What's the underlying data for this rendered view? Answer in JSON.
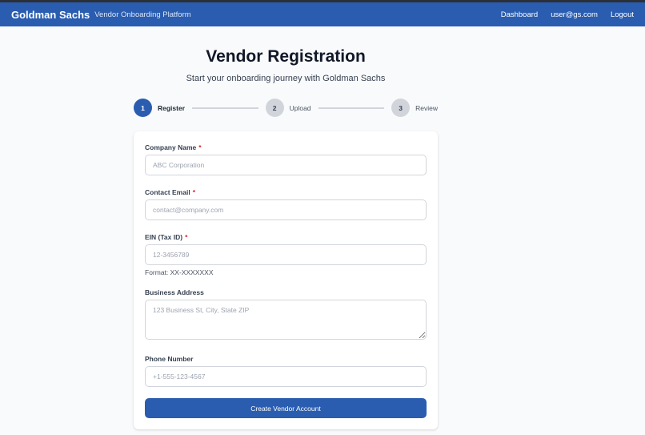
{
  "header": {
    "brand": "Goldman Sachs",
    "subtitle": "Vendor Onboarding Platform",
    "nav": [
      "Dashboard",
      "user@gs.com",
      "Logout"
    ]
  },
  "page": {
    "title": "Vendor Registration",
    "subtitle": "Start your onboarding journey with Goldman Sachs"
  },
  "steps": [
    {
      "number": "1",
      "label": "Register",
      "state": "active"
    },
    {
      "number": "2",
      "label": "Upload",
      "state": "inactive"
    },
    {
      "number": "3",
      "label": "Review",
      "state": "inactive"
    }
  ],
  "form": {
    "company_name": {
      "label": "Company Name",
      "required_mark": "*",
      "placeholder": "ABC Corporation",
      "value": ""
    },
    "contact_email": {
      "label": "Contact Email",
      "required_mark": "*",
      "placeholder": "contact@company.com",
      "value": ""
    },
    "ein": {
      "label": "EIN (Tax ID)",
      "required_mark": "*",
      "placeholder": "12-3456789",
      "value": "",
      "hint": "Format: XX-XXXXXXX"
    },
    "business_address": {
      "label": "Business Address",
      "placeholder": "123 Business St, City, State ZIP",
      "value": ""
    },
    "phone_number": {
      "label": "Phone Number",
      "placeholder": "+1-555-123-4567",
      "value": ""
    },
    "submit_label": "Create Vendor Account"
  },
  "colors": {
    "primary": "#2a5db0",
    "required": "#dc2626",
    "background": "#f9fafb"
  }
}
